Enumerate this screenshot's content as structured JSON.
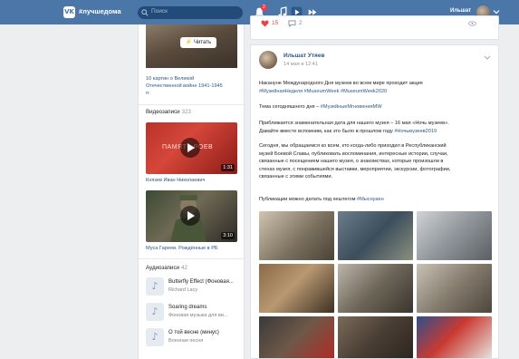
{
  "topbar": {
    "logo": "VK",
    "hashtag": "#лучшедома",
    "search_placeholder": "Поиск",
    "notification_count": "2",
    "user_name": "Ильшат"
  },
  "left": {
    "article": {
      "read_button": "Читать",
      "title_lines": [
        "10 картин о Великой",
        "Отечественной войне 1941-1945",
        "гг."
      ]
    },
    "videos_header": "Видеозаписи",
    "videos_count": "323",
    "videos": [
      {
        "banner": "ПАМЯТЬ  РОЕВ",
        "duration": "1:31",
        "title": "Князев Иван Николаевич"
      },
      {
        "banner": "",
        "duration": "3:10",
        "title": "Муса Гареев. Рождённые в РБ"
      }
    ],
    "audio_header": "Аудиозаписи",
    "audio_count": "42",
    "audios": [
      {
        "title": "Butterfly Effect (Фоновая...",
        "artist": "Richard Lacy"
      },
      {
        "title": "Soaring dreams",
        "artist": "Фоновая музыка для ви..."
      },
      {
        "title": "О той весне (минус)",
        "artist": "Военная песня"
      }
    ]
  },
  "top_card": {
    "likes": "15",
    "comments": "2"
  },
  "post": {
    "author": "Ильшат Утяев",
    "date": "14 мая в 12:41",
    "p1": "Накануне Международного Дня музеев во всем мире проходит акция",
    "p1_tags": "#МузейнаяНеделя #MuseumWeek #MuseumWeek2020",
    "p2_text": "Тема сегодняшнего дня – ",
    "p2_tag": "#МузейныеМгновенияMW",
    "p3_line1": "Приближается знаменательная дата для нашего музея – 16 мая «Ночь музеев».",
    "p3_line2_text": "Давайте вместе вспомним, как это было в прошлом году ",
    "p3_line2_tag": "#Ночьмузеев2019",
    "p4_lines": [
      "Сегодня, мы обращаемся ко всем, кто когда-либо приходил в Республиканский",
      "музей Боевой Славы, публиковать воспоминания, интересные истории, случаи,",
      "связанные с посещением нашего музея, о знакомствах, которые произошли в",
      "стенах музея, с понравившейся выставки, мероприятии, экскурсии, фотографии,",
      "связанные с этими событиями."
    ],
    "p5_text": "Публикации можно делать под хештегом ",
    "p5_tag": "#Мыснуаен"
  },
  "colors": {
    "topbar": "#4a76a8",
    "link": "#2a5885",
    "background": "#edeef0",
    "like": "#e64646"
  }
}
